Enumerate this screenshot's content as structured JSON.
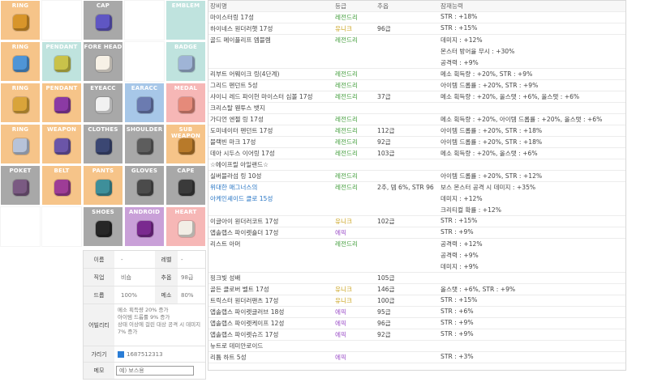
{
  "slots": [
    {
      "label": "RING",
      "color": "#f6c489",
      "icon_color": "#d8952a",
      "icon": "ring-icon"
    },
    {
      "label": "",
      "color": "",
      "icon_color": "",
      "icon": ""
    },
    {
      "label": "CAP",
      "color": "#a8a8a8",
      "icon_color": "#5f56c3",
      "icon": "cap-icon"
    },
    {
      "label": "",
      "color": "",
      "icon_color": "",
      "icon": ""
    },
    {
      "label": "EMBLEM",
      "color": "#bfe3de",
      "icon_color": "",
      "icon": ""
    },
    {
      "label": "RING",
      "color": "#f6c489",
      "icon_color": "#4f95d6",
      "icon": "ring-icon"
    },
    {
      "label": "PENDANT",
      "color": "#bfe3de",
      "icon_color": "#c9c24a",
      "icon": "pendant-icon"
    },
    {
      "label": "FORE HEAD",
      "color": "#a8a8a8",
      "icon_color": "#f7f1e6",
      "icon": "face-accessory-icon"
    },
    {
      "label": "",
      "color": "",
      "icon_color": "",
      "icon": ""
    },
    {
      "label": "BADGE",
      "color": "#bfe3de",
      "icon_color": "#9fb4d6",
      "icon": "badge-icon"
    },
    {
      "label": "RING",
      "color": "#f6c489",
      "icon_color": "#d9a43a",
      "icon": "ring-icon"
    },
    {
      "label": "PENDANT",
      "color": "#f6c489",
      "icon_color": "#8b3aa4",
      "icon": "pendant-icon"
    },
    {
      "label": "EYEACC",
      "color": "#a8a8a8",
      "icon_color": "#f1f1f1",
      "icon": "eye-accessory-icon"
    },
    {
      "label": "EARACC",
      "color": "#a7c7e8",
      "icon_color": "#6b7bb0",
      "icon": "earring-icon"
    },
    {
      "label": "MEDAL",
      "color": "#f6b7b6",
      "icon_color": "#e58a7a",
      "icon": "medal-icon"
    },
    {
      "label": "RING",
      "color": "#f6c489",
      "icon_color": "#b7c3d9",
      "icon": "ring-icon"
    },
    {
      "label": "WEAPON",
      "color": "#f6c489",
      "icon_color": "#6b55a8",
      "icon": "weapon-icon"
    },
    {
      "label": "CLOTHES",
      "color": "#a8a8a8",
      "icon_color": "#3b4773",
      "icon": "clothes-icon"
    },
    {
      "label": "SHOULDER",
      "color": "#a8a8a8",
      "icon_color": "#5d5d5d",
      "icon": "shoulder-icon"
    },
    {
      "label": "SUB WEAPON",
      "color": "#f6c489",
      "icon_color": "#b87a2a",
      "icon": "sub-weapon-icon"
    },
    {
      "label": "POKET",
      "color": "#a8a8a8",
      "icon_color": "#7a5a82",
      "icon": "pocket-icon"
    },
    {
      "label": "BELT",
      "color": "#f6c489",
      "icon_color": "#9e3c96",
      "icon": "belt-icon"
    },
    {
      "label": "PANTS",
      "color": "#f6c489",
      "icon_color": "#3e8f9a",
      "icon": "pants-icon"
    },
    {
      "label": "GLOVES",
      "color": "#a8a8a8",
      "icon_color": "#4b4b4b",
      "icon": "gloves-icon"
    },
    {
      "label": "CAPE",
      "color": "#a8a8a8",
      "icon_color": "#3a3a3a",
      "icon": "cape-icon"
    },
    {
      "label": "",
      "color": "",
      "icon_color": "",
      "icon": ""
    },
    {
      "label": "",
      "color": "",
      "icon_color": "",
      "icon": ""
    },
    {
      "label": "SHOES",
      "color": "#a8a8a8",
      "icon_color": "#262626",
      "icon": "shoes-icon"
    },
    {
      "label": "ANDROID",
      "color": "#c9a0d8",
      "icon_color": "#7a2a8f",
      "icon": "android-icon"
    },
    {
      "label": "HEART",
      "color": "#f6b7b6",
      "icon_color": "#f2eee6",
      "icon": "heart-icon"
    }
  ],
  "info": {
    "name_head": "이름",
    "name_val": "-",
    "level_head": "레벨",
    "level_val": "-",
    "job_head": "직업",
    "job_val": "비숍",
    "fame_head": "추옵",
    "fame_val": "98급",
    "drop_head": "드롭",
    "drop_val": "100%",
    "meso_head": "메소",
    "meso_val": "80%",
    "ability_head": "어빌리티",
    "ability_lines": [
      "메소 획득량 20% 증가",
      "아이템 드롭률 9% 증가",
      "상태 이상에 걸린 대상 공격 시 데미지",
      "7% 증가"
    ],
    "hide_head": "가리기",
    "hide_val": "1687512313",
    "memo_head": "메모",
    "memo_placeholder": "예) 보스용"
  },
  "list": {
    "headers": {
      "name": "장비명",
      "grade": "등급",
      "star": "추옵",
      "pot": "잠재능력"
    },
    "rows": [
      {
        "name": "마이스터링 17성",
        "grade": "레전드리",
        "grade_class": "g-legendary",
        "star": "",
        "pot": [
          "STR : +18%"
        ]
      },
      {
        "name": "하이네스 원더러햇 17성",
        "grade": "유니크",
        "grade_class": "g-unique",
        "star": "96급",
        "pot": [
          "STR : +15%"
        ]
      },
      {
        "name": "골드 메이플리프 엠블렘",
        "grade": "레전드리",
        "grade_class": "g-legendary",
        "star": "",
        "pot": [
          "데미지 : +12%",
          "몬스터 방어율 무시 : +30%",
          "공격력 : +9%"
        ]
      },
      {
        "name": "리부트 어웨이크 링(4단계)",
        "grade": "레전드리",
        "grade_class": "g-legendary",
        "star": "",
        "pot": [
          "메소 획득량 : +20%, STR : +9%"
        ]
      },
      {
        "name": "그리드 펜던트 5성",
        "grade": "레전드리",
        "grade_class": "g-legendary",
        "star": "",
        "pot": [
          "아이템 드롭률 : +20%, STR : +9%"
        ]
      },
      {
        "name": "샤이니 레드 파이헌 마이스터 심볼 17성",
        "grade": "레전드리",
        "grade_class": "g-legendary",
        "star": "37급",
        "pot": [
          "메소 획득량 : +20%, 올스탯 : +6%, 올스탯 : +6%"
        ]
      },
      {
        "name": "크리스탈 웬투스 뱃지",
        "grade": "",
        "grade_class": "",
        "star": "",
        "pot": [
          ""
        ]
      },
      {
        "name": "가디언 엔젤 링 17성",
        "grade": "레전드리",
        "grade_class": "g-legendary",
        "star": "",
        "pot": [
          "메소 획득량 : +20%, 아이템 드롭률 : +20%, 올스탯 : +6%"
        ]
      },
      {
        "name": "도미네이터 펜던트 17성",
        "grade": "레전드리",
        "grade_class": "g-legendary",
        "star": "112급",
        "pot": [
          "아이템 드롭률 : +20%, STR : +18%"
        ]
      },
      {
        "name": "블랙빈 마크 17성",
        "grade": "레전드리",
        "grade_class": "g-legendary",
        "star": "92급",
        "pot": [
          "아이템 드롭률 : +20%, STR : +18%"
        ]
      },
      {
        "name": "데아 시두스 이어링 17성",
        "grade": "레전드리",
        "grade_class": "g-legendary",
        "star": "103급",
        "pot": [
          "메소 획득량 : +20%, 올스탯 : +6%"
        ]
      },
      {
        "name": "☆에이프릴 아일랜드☆",
        "grade": "",
        "grade_class": "",
        "star": "",
        "pot": [
          ""
        ]
      },
      {
        "name": "실버블라섬 링 10성",
        "grade": "레전드리",
        "grade_class": "g-legendary",
        "star": "",
        "pot": [
          "아이템 드롭률 : +20%, STR : +12%"
        ]
      },
      {
        "name": "위대한 매그너스의\n아케인셰이드 클로 15성",
        "name_class": "blue-name",
        "grade": "레전드리",
        "grade_class": "g-legendary",
        "star": "2추, 뎀 6%, STR 96",
        "pot": [
          "보스 몬스터 공격 시 데미지 : +35%",
          "데미지 : +12%",
          "크리티컬 확률 : +12%"
        ]
      },
      {
        "name": "이글아이 원더러코트 17성",
        "grade": "유니크",
        "grade_class": "g-unique",
        "star": "102급",
        "pot": [
          "STR : +15%"
        ]
      },
      {
        "name": "앱솔랩스 파이렛숄더 17성",
        "grade": "에픽",
        "grade_class": "g-epic",
        "star": "",
        "pot": [
          "STR : +9%"
        ]
      },
      {
        "name": "리스트 아머",
        "grade": "레전드리",
        "grade_class": "g-legendary",
        "star": "",
        "pot": [
          "공격력 : +12%",
          "공격력 : +9%",
          "데미지 : +9%"
        ]
      },
      {
        "name": "핑크빛 성배",
        "grade": "",
        "grade_class": "",
        "star": "105급",
        "pot": [
          ""
        ]
      },
      {
        "name": "골든 클로버 벨트 17성",
        "grade": "유니크",
        "grade_class": "g-unique",
        "star": "146급",
        "pot": [
          "올스탯 : +6%, STR : +9%"
        ]
      },
      {
        "name": "트릭스터 원더러팬츠 17성",
        "grade": "유니크",
        "grade_class": "g-unique",
        "star": "100급",
        "pot": [
          "STR : +15%"
        ]
      },
      {
        "name": "앱솔랩스 파이렛글러브 18성",
        "grade": "에픽",
        "grade_class": "g-epic",
        "star": "95급",
        "pot": [
          "STR : +6%"
        ]
      },
      {
        "name": "앱솔랩스 파이렛케이프 12성",
        "grade": "에픽",
        "grade_class": "g-epic",
        "star": "96급",
        "pot": [
          "STR : +9%"
        ]
      },
      {
        "name": "앱솔랩스 파이렛슈즈 17성",
        "grade": "에픽",
        "grade_class": "g-epic",
        "star": "92급",
        "pot": [
          "STR : +9%"
        ]
      },
      {
        "name": "뉴트로 데미안로이드",
        "grade": "",
        "grade_class": "",
        "star": "",
        "pot": [
          ""
        ]
      },
      {
        "name": "리튬 하트 5성",
        "grade": "에픽",
        "grade_class": "g-epic",
        "star": "",
        "pot": [
          "STR : +3%"
        ]
      }
    ]
  }
}
